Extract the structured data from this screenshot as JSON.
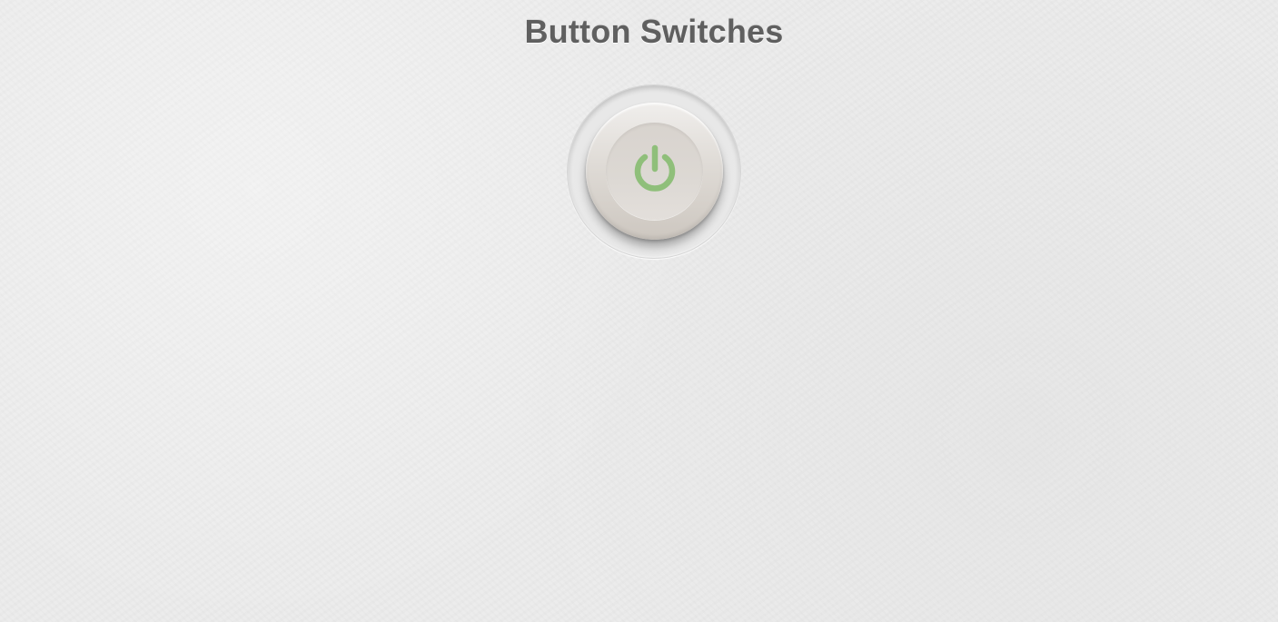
{
  "page": {
    "title": "Button Switches"
  },
  "switch": {
    "icon": "power-icon",
    "state": "on",
    "icon_color": "#8fbf7a"
  }
}
